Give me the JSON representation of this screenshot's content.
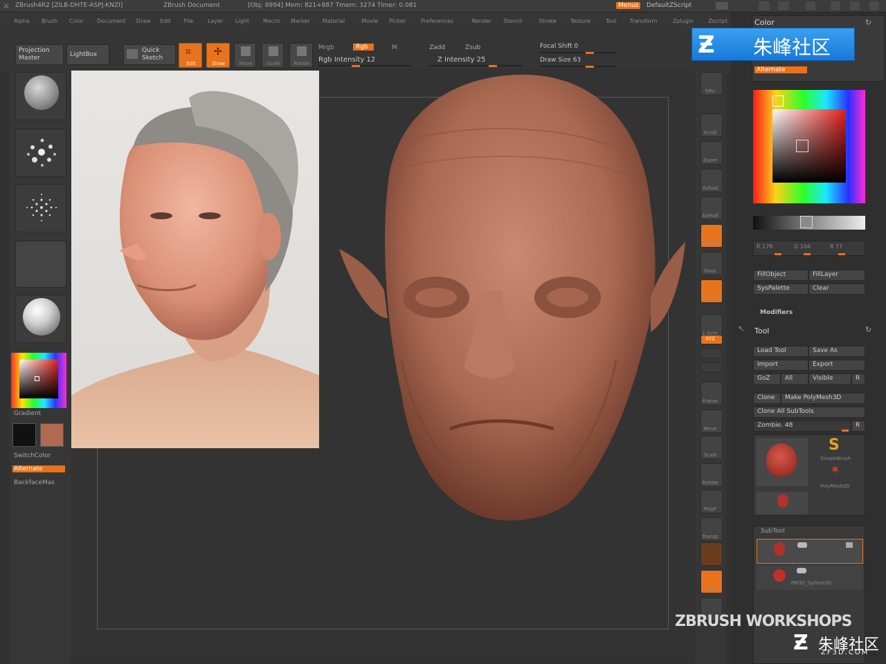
{
  "title_bar": {
    "app": "ZBrush4R2  [ZILB-DHTE-ASPJ-KNZI]",
    "doc": "ZBrush Document",
    "stats": "[Obj: 8994] Mem: 821+887  Tmem: 3274  Timer: 0.081",
    "menus_btn": "Menus",
    "script": "DefaultZScript"
  },
  "menu": [
    "Alpha",
    "Brush",
    "Color",
    "Document",
    "Draw",
    "Edit",
    "File",
    "Layer",
    "Light",
    "Macro",
    "Marker",
    "Material",
    "Movie",
    "Picker",
    "Preferences",
    "Render",
    "Stencil",
    "Stroke",
    "Texture",
    "Tool",
    "Transform",
    "Zplugin",
    "Zscript"
  ],
  "top_shelf": {
    "projection_master": "Projection Master",
    "lightbox": "LightBox",
    "quick_sketch": "Quick Sketch",
    "edit": "Edit",
    "draw": "Draw",
    "move": "Move",
    "scale": "Scale",
    "rotate": "Rotate",
    "mrgb": "Mrgb",
    "rgb": "Rgb",
    "m": "M",
    "rgb_intensity": "Rgb Intensity 12",
    "zadd": "Zadd",
    "zsub": "Zsub",
    "z_intensity": "Z Intensity 25",
    "focal_shift": "Focal Shift 0",
    "draw_size": "Draw Size 63"
  },
  "left_shelf": {
    "gradient": "Gradient",
    "switch_color": "SwitchColor",
    "alternate": "Alternate",
    "backface": "BackfaceMas"
  },
  "right_shelf": [
    "SPix",
    "Scroll",
    "Zoom",
    "Actual",
    "AAHalf",
    "Persp",
    "Floor",
    "Local",
    "L.Sym",
    "XYZ",
    "",
    "",
    "Frame",
    "Move",
    "Scale",
    "Rotate",
    "PolyF",
    "Transp",
    "",
    "Solo",
    ""
  ],
  "right_panel": {
    "color_title": "Color",
    "alternate": "Alternate",
    "r": "R 178",
    "g": "G 104",
    "b": "B 77",
    "fill_object": "FillObject",
    "fill_layer": "FillLayer",
    "sys_palette": "SysPalette",
    "clear": "Clear",
    "modifiers": "Modifiers",
    "tool_title": "Tool",
    "load_tool": "Load Tool",
    "save_as": "Save As",
    "import": "Import",
    "export": "Export",
    "goz": "GoZ",
    "all": "All",
    "visible": "Visible",
    "r_btn": "R",
    "clone": "Clone",
    "make_polymesh": "Make PolyMesh3D",
    "clone_all": "Clone All SubTools",
    "tool_name": "Zombie. 48",
    "simple_brush": "SimpleBrush",
    "polymesh3d": "PolyMesh3D",
    "subtool": "SubTool",
    "pm3d_sphere": "PM3D_Sphere3D"
  },
  "watermarks": {
    "banner": "朱峰社区",
    "workshops": "ZBRUSH WORKSHOPS",
    "corner": "朱峰社区",
    "corner_url": "ZF3D.COM"
  },
  "colors": {
    "accent": "#e8731c",
    "skin": "#b06a4f",
    "banner": "#1f8fe6"
  }
}
